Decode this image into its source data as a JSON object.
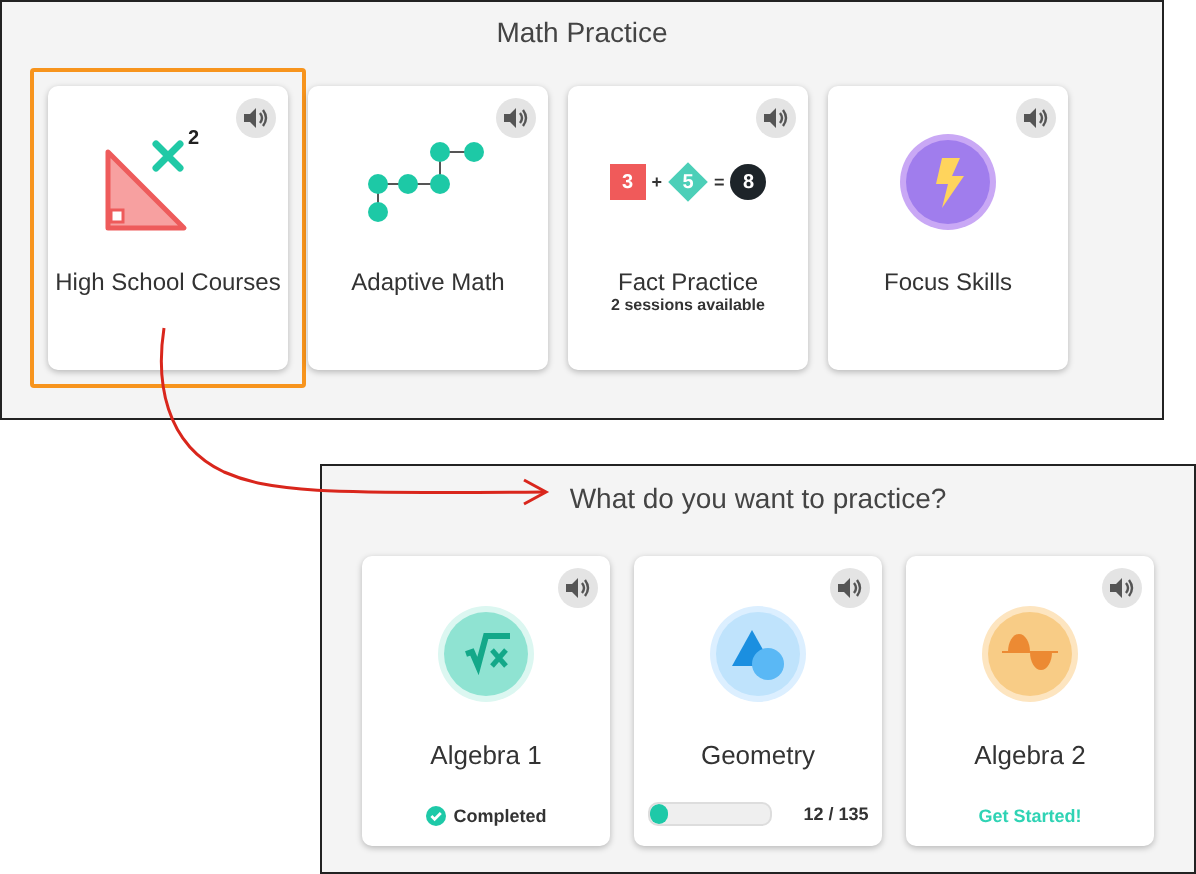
{
  "top_panel": {
    "title": "Math Practice",
    "cards": [
      {
        "label": "High School Courses",
        "highlighted": true,
        "exponent": "2"
      },
      {
        "label": "Adaptive Math",
        "highlighted": false
      },
      {
        "label": "Fact Practice",
        "subtitle": "2 sessions available",
        "highlighted": false,
        "equation": [
          {
            "kind": "square",
            "text": "3"
          },
          {
            "kind": "op",
            "text": "+"
          },
          {
            "kind": "diamond",
            "text": "5"
          },
          {
            "kind": "op",
            "text": "="
          },
          {
            "kind": "circle",
            "text": "8"
          }
        ]
      },
      {
        "label": "Focus Skills",
        "highlighted": false
      }
    ]
  },
  "bottom_panel": {
    "title": "What do you want to practice?",
    "courses": [
      {
        "label": "Algebra 1",
        "status": {
          "kind": "completed",
          "text": "Completed"
        }
      },
      {
        "label": "Geometry",
        "status": {
          "kind": "progress",
          "level": 0.15,
          "reading": "12 / 135"
        }
      },
      {
        "label": "Algebra 2",
        "status": {
          "kind": "start",
          "text": "Get Started!"
        }
      }
    ]
  }
}
